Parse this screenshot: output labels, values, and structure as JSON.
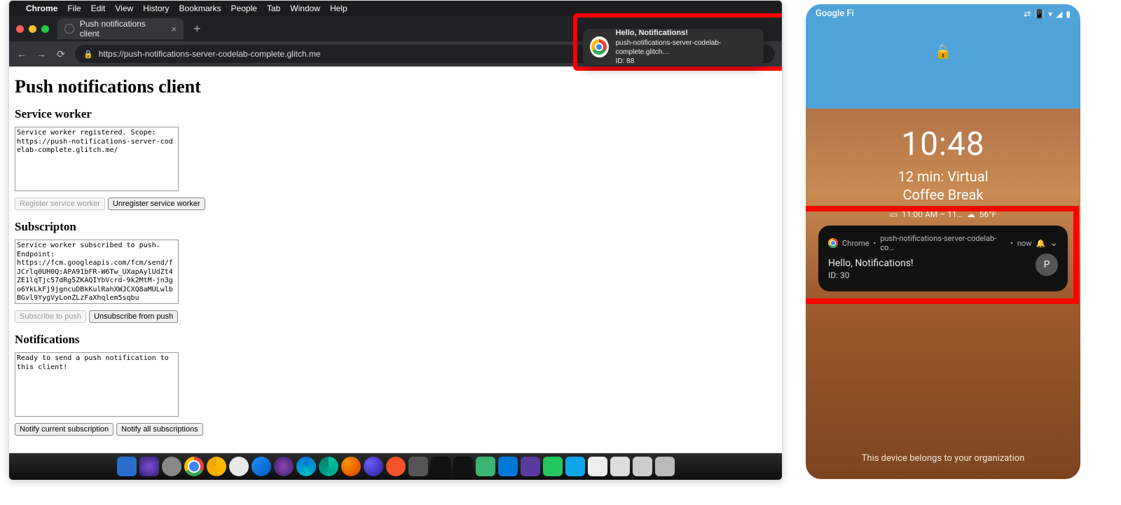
{
  "mac": {
    "menu": {
      "app": "Chrome",
      "items": [
        "File",
        "Edit",
        "View",
        "History",
        "Bookmarks",
        "People",
        "Tab",
        "Window",
        "Help"
      ]
    },
    "tab": {
      "title": "Push notifications client"
    },
    "url": "https://push-notifications-server-codelab-complete.glitch.me",
    "notification": {
      "title": "Hello, Notifications!",
      "origin": "push-notifications-server-codelab-complete.glitch…",
      "body": "ID: 88"
    }
  },
  "page": {
    "h1": "Push notifications client",
    "sw": {
      "heading": "Service worker",
      "text": "Service worker registered. Scope:\nhttps://push-notifications-server-codelab-complete.glitch.me/",
      "register": "Register service worker",
      "unregister": "Unregister service worker"
    },
    "sub": {
      "heading": "Subscripton",
      "text": "Service worker subscribed to push.\nEndpoint:\nhttps://fcm.googleapis.com/fcm/send/fJCrlq0UH0Q:APA91bFR-W6Tw_UXapAylUdZt4ZE1lqTjc57dRg5ZKAQIYbVcrd-9k2MtM-jn3go6YkLkFj9jgncuDBkKulRahXWJCXQ8aMULwlbBGvl9YygVyLonZLzFaXhqlem5sqbu",
      "subscribe": "Subscribe to push",
      "unsubscribe": "Unsubscribe from push"
    },
    "notif": {
      "heading": "Notifications",
      "text": "Ready to send a push notification to this client!",
      "notify_current": "Notify current subscription",
      "notify_all": "Notify all subscriptions"
    }
  },
  "phone": {
    "carrier": "Google Fi",
    "clock": "10:48",
    "event_line1": "12 min:  Virtual",
    "event_line2": "Coffee Break",
    "weather_time": "11:00 AM – 11…",
    "weather_temp": "56°F",
    "notification": {
      "app": "Chrome",
      "origin": "push-notifications-server-codelab-co…",
      "time": "now",
      "title": "Hello, Notifications!",
      "body": "ID: 30",
      "avatar": "P"
    },
    "footer": "This device belongs to your organization"
  }
}
